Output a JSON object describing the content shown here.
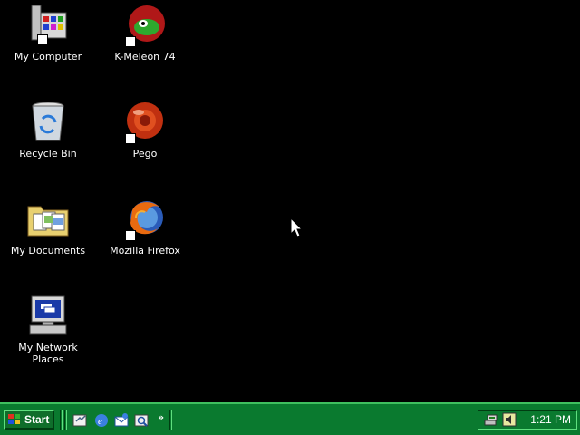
{
  "desktop": {
    "background": "#000000",
    "icons": [
      {
        "label": "My Computer",
        "icon": "my-computer-icon"
      },
      {
        "label": "K-Meleon 74",
        "icon": "k-meleon-icon"
      },
      {
        "label": "Recycle Bin",
        "icon": "recycle-bin-icon"
      },
      {
        "label": "Pego",
        "icon": "pego-icon"
      },
      {
        "label": "My Documents",
        "icon": "my-documents-icon"
      },
      {
        "label": "Mozilla Firefox",
        "icon": "firefox-icon"
      },
      {
        "label": "My Network Places",
        "icon": "my-network-places-icon"
      }
    ]
  },
  "taskbar": {
    "color": "#0a7a2f",
    "start_label": "Start",
    "quick_launch": [
      {
        "icon": "show-desktop-icon"
      },
      {
        "icon": "internet-explorer-icon"
      },
      {
        "icon": "outlook-express-icon"
      },
      {
        "icon": "search-icon"
      }
    ],
    "more_label": "»",
    "tray": {
      "icons": [
        "network-icon",
        "volume-icon"
      ],
      "clock": "1:21 PM"
    }
  }
}
